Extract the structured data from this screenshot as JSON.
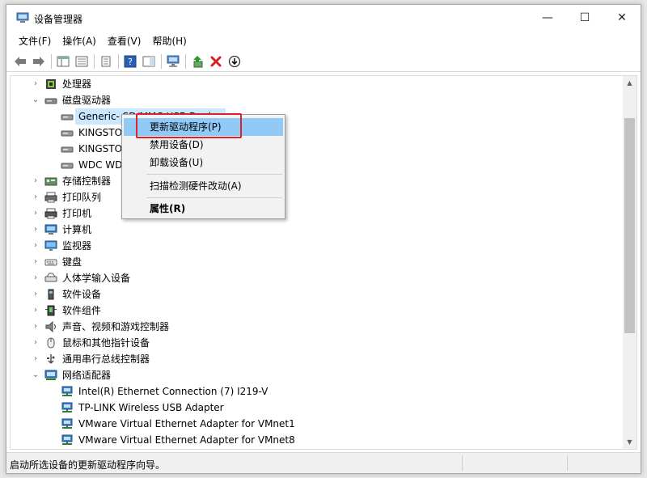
{
  "window": {
    "title": "设备管理器",
    "min": "—",
    "max": "☐",
    "close": "✕"
  },
  "menu": [
    "文件(F)",
    "操作(A)",
    "查看(V)",
    "帮助(H)"
  ],
  "tree": [
    {
      "level": 1,
      "arrow": "›",
      "icon": "cpu-icon",
      "label": "处理器"
    },
    {
      "level": 1,
      "arrow": "⌄",
      "icon": "disk-drive-icon",
      "label": "磁盘驱动器"
    },
    {
      "level": 2,
      "arrow": "",
      "icon": "disk-icon",
      "label": "Generic- SD/MMC USB Device",
      "selected": true
    },
    {
      "level": 2,
      "arrow": "",
      "icon": "disk-icon",
      "label": "KINGSTON SA400S37240G"
    },
    {
      "level": 2,
      "arrow": "",
      "icon": "disk-icon",
      "label": "KINGSTON SA400S37480G"
    },
    {
      "level": 2,
      "arrow": "",
      "icon": "disk-icon",
      "label": "WDC WD10EZEX-08WN4A0"
    },
    {
      "level": 1,
      "arrow": "›",
      "icon": "storage-controller-icon",
      "label": "存储控制器"
    },
    {
      "level": 1,
      "arrow": "›",
      "icon": "print-queue-icon",
      "label": "打印队列"
    },
    {
      "level": 1,
      "arrow": "›",
      "icon": "printer-icon",
      "label": "打印机"
    },
    {
      "level": 1,
      "arrow": "›",
      "icon": "computer-icon",
      "label": "计算机"
    },
    {
      "level": 1,
      "arrow": "›",
      "icon": "monitor-icon",
      "label": "监视器"
    },
    {
      "level": 1,
      "arrow": "›",
      "icon": "keyboard-icon",
      "label": "键盘"
    },
    {
      "level": 1,
      "arrow": "›",
      "icon": "hid-icon",
      "label": "人体学输入设备"
    },
    {
      "level": 1,
      "arrow": "›",
      "icon": "software-device-icon",
      "label": "软件设备"
    },
    {
      "level": 1,
      "arrow": "›",
      "icon": "software-component-icon",
      "label": "软件组件"
    },
    {
      "level": 1,
      "arrow": "›",
      "icon": "sound-icon",
      "label": "声音、视频和游戏控制器"
    },
    {
      "level": 1,
      "arrow": "›",
      "icon": "mouse-icon",
      "label": "鼠标和其他指针设备"
    },
    {
      "level": 1,
      "arrow": "›",
      "icon": "usb-icon",
      "label": "通用串行总线控制器"
    },
    {
      "level": 1,
      "arrow": "⌄",
      "icon": "network-icon",
      "label": "网络适配器"
    },
    {
      "level": 2,
      "arrow": "",
      "icon": "network-adapter-icon",
      "label": "Intel(R) Ethernet Connection (7) I219-V"
    },
    {
      "level": 2,
      "arrow": "",
      "icon": "network-adapter-icon",
      "label": "TP-LINK Wireless USB Adapter"
    },
    {
      "level": 2,
      "arrow": "",
      "icon": "network-adapter-icon",
      "label": "VMware Virtual Ethernet Adapter for VMnet1"
    },
    {
      "level": 2,
      "arrow": "",
      "icon": "network-adapter-icon",
      "label": "VMware Virtual Ethernet Adapter for VMnet8"
    }
  ],
  "context_menu": {
    "update_driver": "更新驱动程序(P)",
    "disable_device": "禁用设备(D)",
    "uninstall_device": "卸载设备(U)",
    "scan_hardware": "扫描检测硬件改动(A)",
    "properties": "属性(R)"
  },
  "status": {
    "text": "启动所选设备的更新驱动程序向导。"
  },
  "colors": {
    "selection": "#cce8ff",
    "menu_hover": "#91c9f7",
    "highlight_border": "#e0202a"
  }
}
